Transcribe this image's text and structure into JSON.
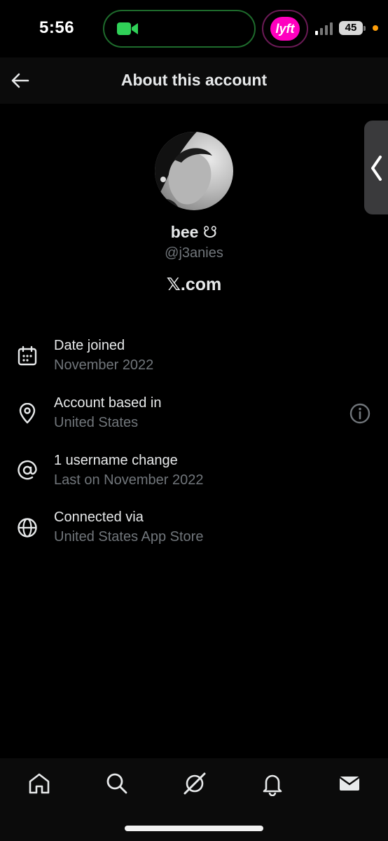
{
  "status_bar": {
    "time": "5:56",
    "battery": "45",
    "lyft_label": "lyft"
  },
  "header": {
    "title": "About this account",
    "back_icon": "arrow-left-icon"
  },
  "profile": {
    "display_name": "bee ☋",
    "handle": "@j3anies",
    "platform": "𝕏.com"
  },
  "info": [
    {
      "icon": "calendar-icon",
      "title": "Date joined",
      "subtitle": "November 2022"
    },
    {
      "icon": "location-pin-icon",
      "title": "Account based in",
      "subtitle": "United States"
    },
    {
      "icon": "at-sign-icon",
      "title": "1 username change",
      "subtitle": "Last on November 2022"
    },
    {
      "icon": "globe-icon",
      "title": "Connected via",
      "subtitle": "United States App Store"
    }
  ],
  "bottom_nav": [
    "home-icon",
    "search-icon",
    "grok-icon",
    "notifications-icon",
    "messages-icon"
  ],
  "colors": {
    "background": "#000000",
    "primary_text": "#e7e9ea",
    "secondary_text": "#71767b",
    "facetime_green": "#30d158",
    "lyft_pink": "#ff00bf"
  }
}
